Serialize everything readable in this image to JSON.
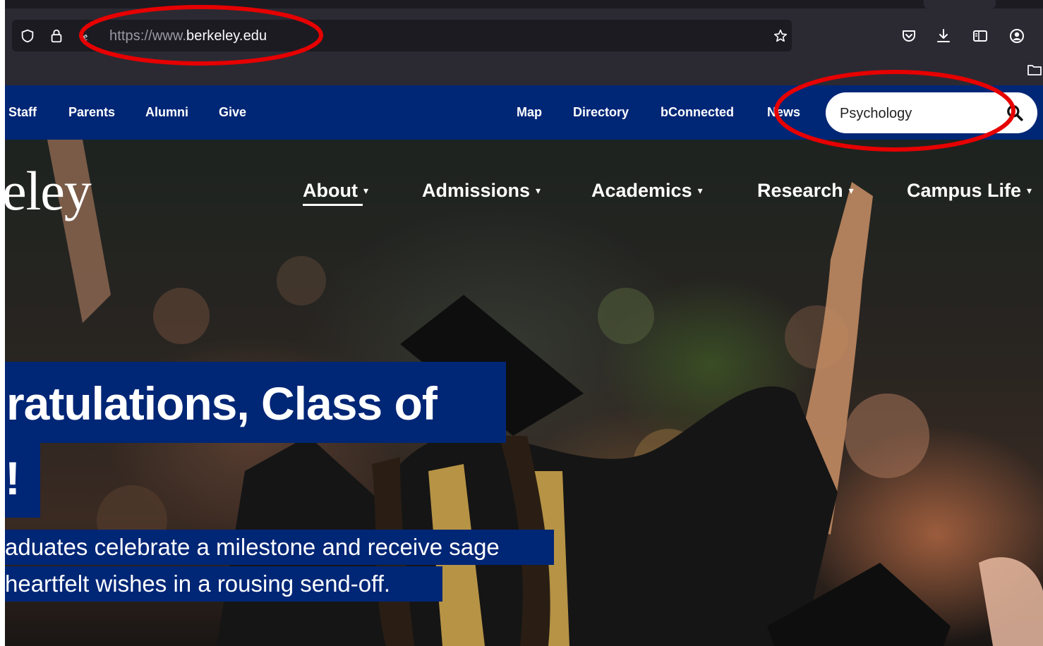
{
  "browser": {
    "url_prefix": "https://www.",
    "url_host": "berkeley.edu",
    "url_partial_char": "ꬲ"
  },
  "utility_nav": {
    "links": [
      "Staff",
      "Parents",
      "Alumni",
      "Give",
      "Map",
      "Directory",
      "bConnected",
      "News"
    ],
    "search_value": "Psychology"
  },
  "brand": {
    "logo_text": "eley",
    "color_primary": "#002676"
  },
  "main_nav": {
    "items": [
      "About",
      "Admissions",
      "Academics",
      "Research",
      "Campus Life"
    ],
    "caret": "▾"
  },
  "hero": {
    "headline_line1": "ratulations, Class of",
    "headline_line2": "!",
    "subtitle_line1": "aduates celebrate a milestone and receive sage",
    "subtitle_line2": "heartfelt wishes in a rousing send-off."
  },
  "annotations": {
    "circle_color": "#e60000"
  }
}
